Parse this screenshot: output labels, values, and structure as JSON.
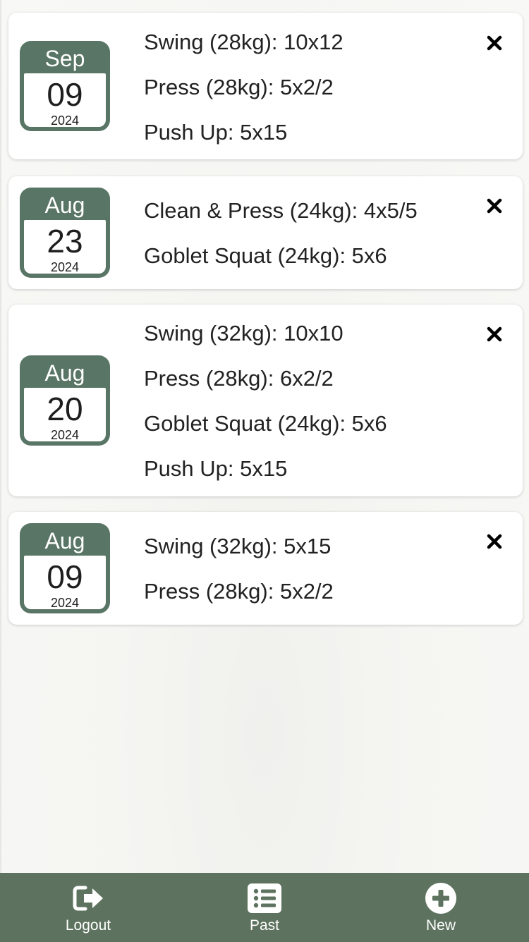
{
  "workouts": [
    {
      "month": "Sep",
      "day": "09",
      "year": "2024",
      "exercises": [
        "Swing (28kg): 10x12",
        "Press (28kg): 5x2/2",
        "Push Up: 5x15"
      ]
    },
    {
      "month": "Aug",
      "day": "23",
      "year": "2024",
      "exercises": [
        "Clean & Press (24kg): 4x5/5",
        "Goblet Squat (24kg): 5x6"
      ]
    },
    {
      "month": "Aug",
      "day": "20",
      "year": "2024",
      "exercises": [
        "Swing (32kg): 10x10",
        "Press (28kg): 6x2/2",
        "Goblet Squat (24kg): 5x6",
        "Push Up: 5x15"
      ]
    },
    {
      "month": "Aug",
      "day": "09",
      "year": "2024",
      "exercises": [
        "Swing (32kg): 5x15",
        "Press (28kg): 5x2/2"
      ]
    }
  ],
  "delete_icon": "close-icon",
  "tabbar": {
    "tabs": [
      {
        "label": "Logout",
        "icon": "logout-icon"
      },
      {
        "label": "Past",
        "icon": "list-icon"
      },
      {
        "label": "New",
        "icon": "plus-circle-icon"
      }
    ]
  },
  "colors": {
    "calendar": "#587565",
    "tabbar": "#5e735f",
    "card": "#ffffff",
    "background": "#f7f7f5"
  }
}
